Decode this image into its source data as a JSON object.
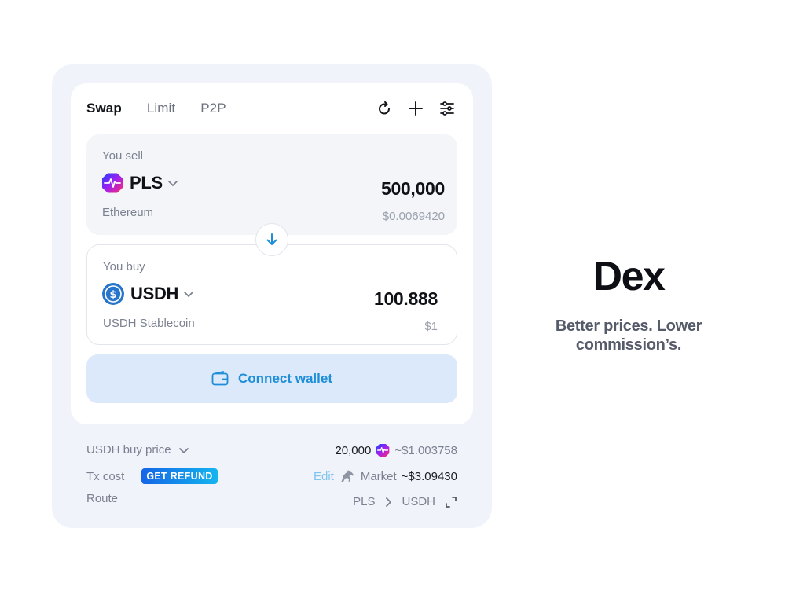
{
  "tabs": [
    "Swap",
    "Limit",
    "P2P"
  ],
  "toolbar": {
    "refresh_icon": "refresh-icon",
    "add_icon": "plus-icon",
    "settings_icon": "sliders-icon"
  },
  "sell": {
    "label": "You sell",
    "symbol": "PLS",
    "network": "Ethereum",
    "amount": "500,000",
    "usd": "$0.0069420"
  },
  "buy": {
    "label": "You buy",
    "symbol": "USDH",
    "network": "USDH Stablecoin",
    "amount": "100.888",
    "usd": "$1"
  },
  "connect": {
    "label": "Connect wallet"
  },
  "info": {
    "price_label": "USDH buy price",
    "price_value": "20,000",
    "price_usd": "~$1.003758",
    "tx_label": "Tx cost",
    "refund_badge": "GET REFUND",
    "edit": "Edit",
    "market_label": "Market",
    "market_value": "~$3.09430",
    "route_label": "Route",
    "route_from": "PLS",
    "route_to": "USDH"
  },
  "hero": {
    "title": "Dex",
    "subtitle_line1": "Better prices. Lower",
    "subtitle_line2": "commission’s."
  },
  "colors": {
    "accent": "#1f8ed8",
    "connect_bg": "#dce9fb",
    "outer_bg": "#f1f3fb"
  }
}
